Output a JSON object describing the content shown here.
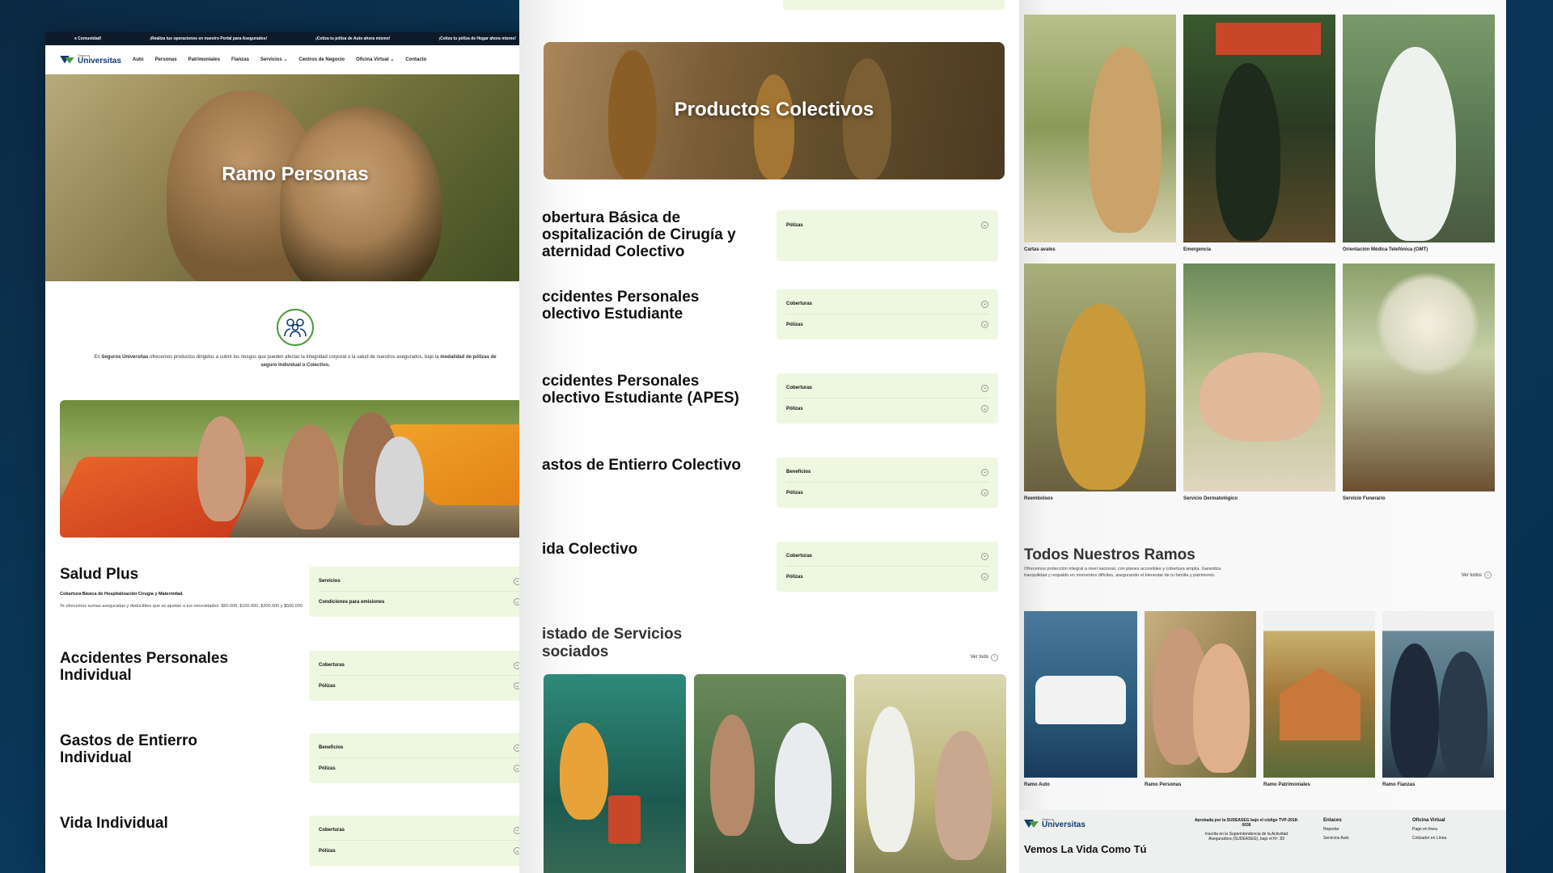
{
  "ticker": [
    "s Comunidad!",
    "¡Realiza tus operaciones en nuestro Portal para Asegurados!",
    "¡Cotiza tu póliza de Auto ahora mismo!",
    "¡Cotiza tu póliza de Hogar ahora mismo!"
  ],
  "logo": {
    "small": "Seguros",
    "big": "Universitas"
  },
  "nav": [
    "Auto",
    "Personas",
    "Patrimoniales",
    "Fianzas",
    "Servicios",
    "Centros de Negocio",
    "Oficina Virtual",
    "Contacto"
  ],
  "hero1": {
    "title": "Ramo Personas"
  },
  "intro": {
    "pre": "En ",
    "brand": "Seguros Universitas",
    "mid": " ofrecemos productos dirigidos a cubrir los riesgos que pueden afectar la integridad corporal o la salud de nuestros asegurados, bajo la ",
    "bold": "modalidad de pólizas de seguro Individual o Colectivo."
  },
  "p1_products": [
    {
      "title": "Salud Plus",
      "subtitle": "Cobertura Básica de Hospitalización Cirugía y Maternidad.",
      "desc": "Te ofrecemos sumas aseguradas y deducibles que se ajustan a tus necesidades: $50.000, $100.000, $200.000 y $500.000",
      "items": [
        "Servicios",
        "Condiciones para emisiones"
      ]
    },
    {
      "title": "Accidentes Personales Individual",
      "items": [
        "Coberturas",
        "Pólizas"
      ]
    },
    {
      "title": "Gastos de Entierro Individual",
      "items": [
        "Beneficios",
        "Pólizas"
      ]
    },
    {
      "title": "Vida Individual",
      "items": [
        "Coberturas",
        "Pólizas"
      ]
    }
  ],
  "hero2": {
    "title": "Productos Colectivos"
  },
  "p2_products": [
    {
      "title": "obertura Básica de ospitalización de Cirugía y aternidad Colectivo",
      "items": [
        "Pólizas"
      ]
    },
    {
      "title": "ccidentes Personales olectivo Estudiante",
      "items": [
        "Coberturas",
        "Pólizas"
      ]
    },
    {
      "title": "ccidentes Personales olectivo Estudiante (APES)",
      "items": [
        "Coberturas",
        "Pólizas"
      ]
    },
    {
      "title": "astos de Entierro Colectivo",
      "items": [
        "Beneficios",
        "Pólizas"
      ]
    },
    {
      "title": "ida Colectivo",
      "items": [
        "Coberturas",
        "Pólizas"
      ]
    }
  ],
  "services_listing": {
    "title": "istado de Servicios sociados",
    "more": "Ver todo"
  },
  "services": [
    "Cartas avales",
    "Emergencia",
    "Orientación Médica Telefónica (OMT)",
    "Reembolsos",
    "Servicio Dermatológico",
    "Servicio Funerario"
  ],
  "ramos": {
    "title": "Todos Nuestros Ramos",
    "desc": "Ofrecemos protección integral a nivel nacional, con planes accesibles y cobertura amplia. Garantiza tranquilidad y respaldo en momentos difíciles, asegurando el bienestar de tu familia y patrimonio.",
    "more": "Ver todos",
    "items": [
      "Ramo Auto",
      "Ramo Personas",
      "Ramo Patrimoniales",
      "Ramo Fianzas"
    ]
  },
  "footer": {
    "tagline": "Vemos La Vida Como Tú",
    "approved": "Aprobada por la SUDEASEG bajo el código TVP-2018-0036",
    "registered": "Inscrita en la Superintendencia de la Actividad Aseguradora (SUDEASEG), bajo el Nº. 83",
    "links_title": "Enlaces",
    "links": [
      "Reportar",
      "Servicios Auto"
    ],
    "office_title": "Oficina Virtual",
    "office": [
      "Pago en línea",
      "Cotizador en Línea"
    ]
  },
  "colors": {
    "accent": "#4f9a3c",
    "brand": "#123a6e",
    "accordion": "#eef7e0",
    "background": "#0a3a5c"
  }
}
